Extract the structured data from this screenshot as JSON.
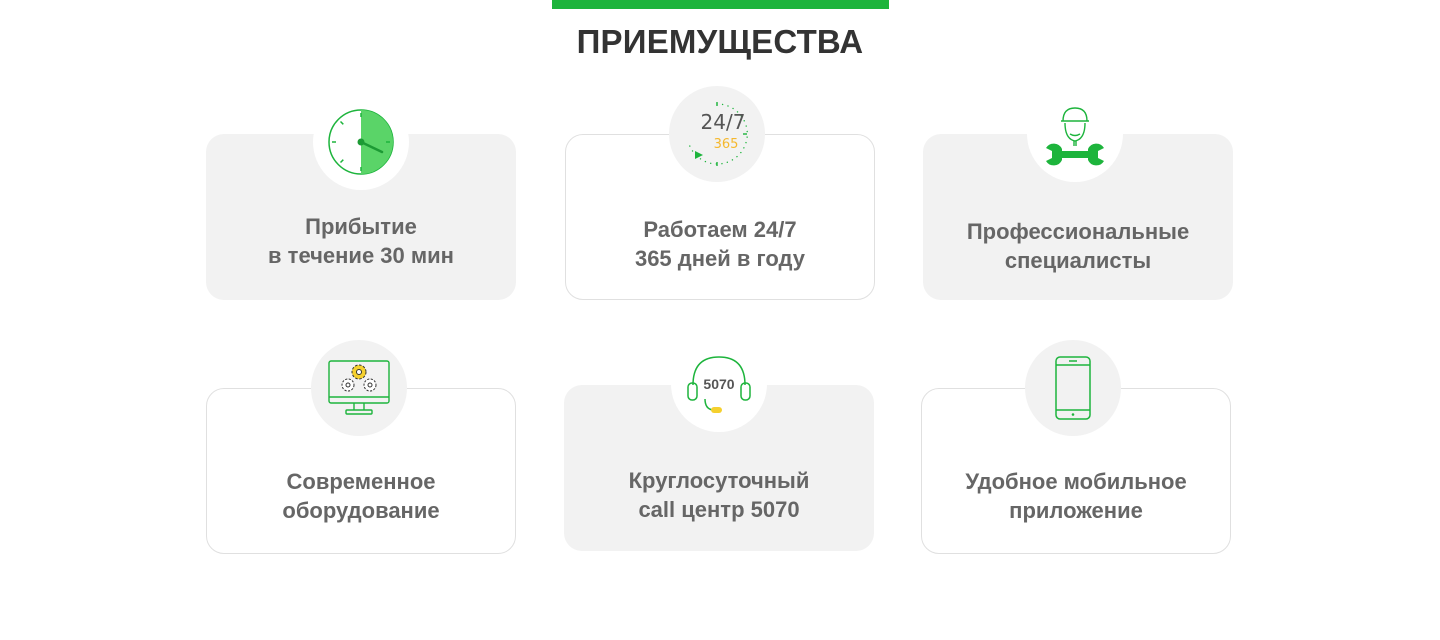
{
  "section": {
    "title": "ПРИЕМУЩЕСТВА"
  },
  "colors": {
    "accent": "#1db43c",
    "card_bg": "#f2f2f2",
    "card_border": "#e0e0e0",
    "text_dark": "#333333",
    "text_grey": "#666666",
    "highlight_yellow": "#f5b82e"
  },
  "advantages": [
    {
      "icon": "stopwatch-icon",
      "line1": "Прибытие",
      "line2": "в течение 30 мин"
    },
    {
      "icon": "clock-24-7-icon",
      "line1": "Работаем 24/7",
      "line2": "365 дней в году",
      "icon_text_main": "24/7",
      "icon_text_sub": "365"
    },
    {
      "icon": "mechanic-icon",
      "line1": "Профессиональные",
      "line2": "специалисты"
    },
    {
      "icon": "monitor-gears-icon",
      "line1": "Современное",
      "line2": "оборудование"
    },
    {
      "icon": "headset-icon",
      "line1": "Круглосуточный",
      "line2": "call центр 5070",
      "icon_text_main": "5070"
    },
    {
      "icon": "smartphone-icon",
      "line1": "Удобное мобильное",
      "line2": "приложение"
    }
  ]
}
